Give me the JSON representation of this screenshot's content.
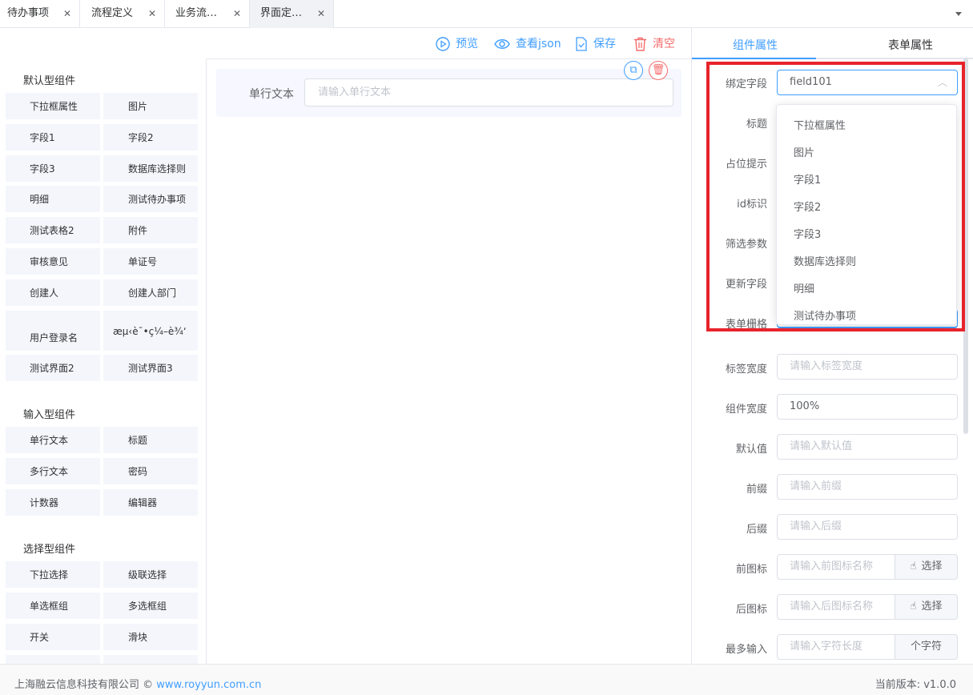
{
  "tabs": [
    {
      "label": "待办事项"
    },
    {
      "label": "流程定义"
    },
    {
      "label": "业务流…"
    },
    {
      "label": "界面定…"
    }
  ],
  "toolbar": {
    "preview": "预览",
    "view_json": "查看json",
    "save": "保存",
    "clear": "清空"
  },
  "palette": {
    "groups": [
      {
        "title": "默认型组件",
        "items": [
          "下拉框属性",
          "图片",
          "字段1",
          "字段2",
          "字段3",
          "数据库选择则",
          "明细",
          "测试待办事项",
          "测试表格2",
          "附件",
          "审核意见",
          "单证号",
          "创建人",
          "创建人部门",
          "用户登录名",
          "æµ‹è¯•ç¼–è¾‘",
          "测试界面2",
          "测试界面3"
        ]
      },
      {
        "title": "输入型组件",
        "items": [
          "单行文本",
          "标题",
          "多行文本",
          "密码",
          "计数器",
          "编辑器"
        ]
      },
      {
        "title": "选择型组件",
        "items": [
          "下拉选择",
          "级联选择",
          "单选框组",
          "多选框组",
          "开关",
          "滑块"
        ]
      }
    ]
  },
  "canvas": {
    "field_label": "单行文本",
    "field_placeholder": "请输入单行文本"
  },
  "right_panel": {
    "tabs": [
      "组件属性",
      "表单属性"
    ],
    "bind_label": "绑定字段",
    "bind_value": "field101",
    "rows": [
      {
        "label": "标题"
      },
      {
        "label": "占位提示"
      },
      {
        "label": "id标识"
      },
      {
        "label": "筛选参数"
      },
      {
        "label": "更新字段"
      },
      {
        "label": "表单栅格"
      },
      {
        "label": "标签宽度",
        "placeholder": "请输入标签宽度"
      },
      {
        "label": "组件宽度",
        "value": "100%"
      },
      {
        "label": "默认值",
        "placeholder": "请输入默认值"
      },
      {
        "label": "前缀",
        "placeholder": "请输入前缀"
      },
      {
        "label": "后缀",
        "placeholder": "请输入后缀"
      },
      {
        "label": "前图标",
        "placeholder": "请输入前图标名称",
        "addon": "选择"
      },
      {
        "label": "后图标",
        "placeholder": "请输入后图标名称",
        "addon": "选择"
      },
      {
        "label": "最多输入",
        "placeholder": "请输入字符长度",
        "addon": "个字符"
      }
    ],
    "dropdown_options": [
      "下拉框属性",
      "图片",
      "字段1",
      "字段2",
      "字段3",
      "数据库选择则",
      "明细",
      "测试待办事项"
    ]
  },
  "footer": {
    "company": "上海融云信息科技有限公司 ©",
    "link": "www.royyun.com.cn",
    "version_label": "当前版本:",
    "version": "v1.0.0"
  },
  "colors": {
    "accent": "#409eff",
    "danger": "#f56c6c",
    "highlight_box": "#e8232b"
  }
}
